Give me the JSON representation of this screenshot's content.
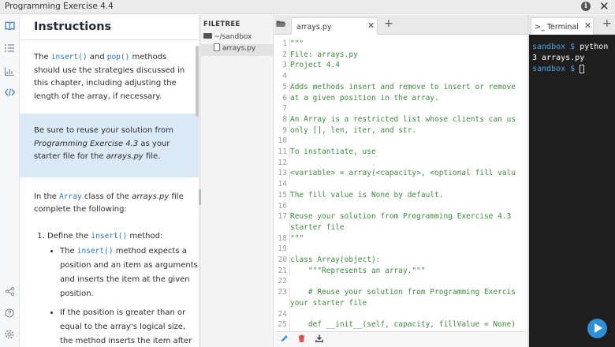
{
  "window": {
    "title": "Programming Exercise 4.4"
  },
  "rail": {
    "icons": [
      "book-icon",
      "list-icon",
      "chart-icon",
      "code-icon",
      "share-icon",
      "help-icon",
      "settings-icon"
    ]
  },
  "instructions": {
    "heading": "Instructions",
    "p1_a": "The ",
    "p1_code1": "insert()",
    "p1_b": " and ",
    "p1_code2": "pop()",
    "p1_c": " methods should use the strategies discussed in this chapter, including adjusting the length of the array, if necessary.",
    "note_a": "Be sure to reuse your solution from ",
    "note_em": "Programming Exercise 4.3",
    "note_b": " as your starter file for the ",
    "note_em2": "arrays.py",
    "note_c": " file.",
    "p2_a": "In the ",
    "p2_code": "Array",
    "p2_b": " class of the ",
    "p2_em": "arrays.py",
    "p2_c": " file complete the following:",
    "item1_a": "Define the ",
    "item1_code": "insert()",
    "item1_b": " method:",
    "bullet1_a": "The ",
    "bullet1_code": "insert()",
    "bullet1_b": " method expects a position and an item as arguments and inserts the item at the given position.",
    "bullet2": "If the position is greater than or equal to the array's logical size, the method inserts the item after"
  },
  "filetree": {
    "header": "FILETREE",
    "folder": "~/sandbox",
    "file": "arrays.py"
  },
  "editor": {
    "tab_label": "arrays.py",
    "lines": [
      {
        "n": "1",
        "t": "\"\"\""
      },
      {
        "n": "2",
        "t": "File: arrays.py"
      },
      {
        "n": "3",
        "t": "Project 4.4"
      },
      {
        "n": "4",
        "t": ""
      },
      {
        "n": "5",
        "t": "Adds methods insert and remove to insert or remove"
      },
      {
        "n": "6",
        "t": "at a given position in the array."
      },
      {
        "n": "7",
        "t": ""
      },
      {
        "n": "8",
        "t": "An Array is a restricted list whose clients can us"
      },
      {
        "n": "9",
        "t": "only [], len, iter, and str."
      },
      {
        "n": "10",
        "t": ""
      },
      {
        "n": "11",
        "t": "To instantiate, use"
      },
      {
        "n": "12",
        "t": ""
      },
      {
        "n": "13",
        "t": "<variable> = array(<capacity>, <optional fill valu"
      },
      {
        "n": "14",
        "t": ""
      },
      {
        "n": "15",
        "t": "The fill value is None by default."
      },
      {
        "n": "16",
        "t": ""
      },
      {
        "n": "17",
        "t": "Reuse your solution from Programming Exercise 4.3"
      },
      {
        "n": "",
        "t": "starter file"
      },
      {
        "n": "18",
        "t": "\"\"\""
      },
      {
        "n": "19",
        "t": ""
      },
      {
        "n": "20",
        "t": "class Array(object):"
      },
      {
        "n": "21",
        "t": "    \"\"\"Represents an array.\"\"\""
      },
      {
        "n": "22",
        "t": ""
      },
      {
        "n": "23",
        "t": "    # Reuse your solution from Programming Exercis"
      },
      {
        "n": "",
        "t": "your starter file"
      },
      {
        "n": "24",
        "t": ""
      },
      {
        "n": "25",
        "t": "    def __init__(self, capacity, fillValue = None)"
      }
    ],
    "toolbar_icons": [
      "edit-icon",
      "delete-icon",
      "download-icon"
    ]
  },
  "terminal": {
    "tab_label": ">_ Terminal",
    "line1_prompt": "sandbox $ ",
    "line1_cmd": "python",
    "line2": "3 arrays.py",
    "line3_prompt": "sandbox $ "
  },
  "colors": {
    "accent": "#2f8fd6",
    "code_green": "#3c8a3c",
    "inline_code": "#2a72c4",
    "note_bg": "#dbe9f6",
    "terminal_bg": "#1e1e1e"
  }
}
